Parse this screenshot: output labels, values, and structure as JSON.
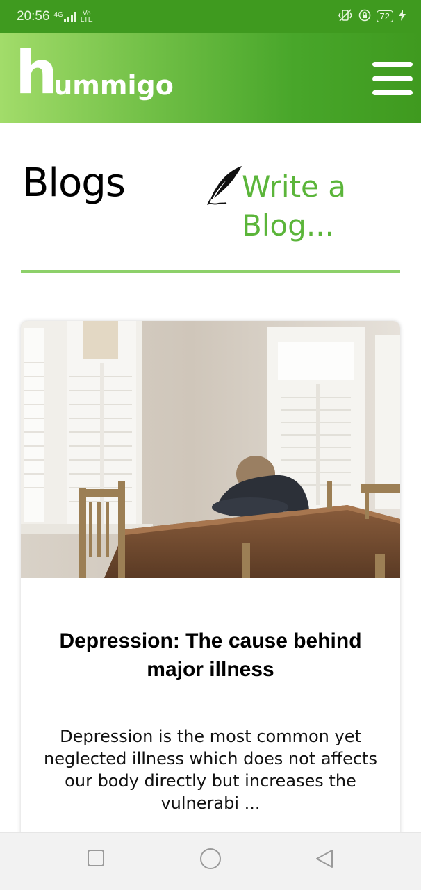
{
  "status_bar": {
    "time": "20:56",
    "network": "4G",
    "volte_top": "Vo",
    "volte_bottom": "LTE",
    "battery": "72"
  },
  "header": {
    "logo_initial": "h",
    "logo_rest": "ummigo",
    "menu_icon": "hamburger-menu-icon"
  },
  "page": {
    "title": "Blogs",
    "write_link": "Write a Blog...",
    "write_icon": "quill-pen-icon"
  },
  "blog_card": {
    "image_description_icon": "blog-photo",
    "title": "Depression: The cause behind major illness",
    "excerpt": "Depression is the most common yet neglected illness which does not affects our body directly but increases the vulnerabi ..."
  },
  "nav_bar": {
    "recents_icon": "square-recents-icon",
    "home_icon": "circle-home-icon",
    "back_icon": "triangle-back-icon"
  },
  "colors": {
    "brand_green": "#5bb53a",
    "status_green": "#3f9a1f",
    "divider_green": "#8dd06a"
  }
}
